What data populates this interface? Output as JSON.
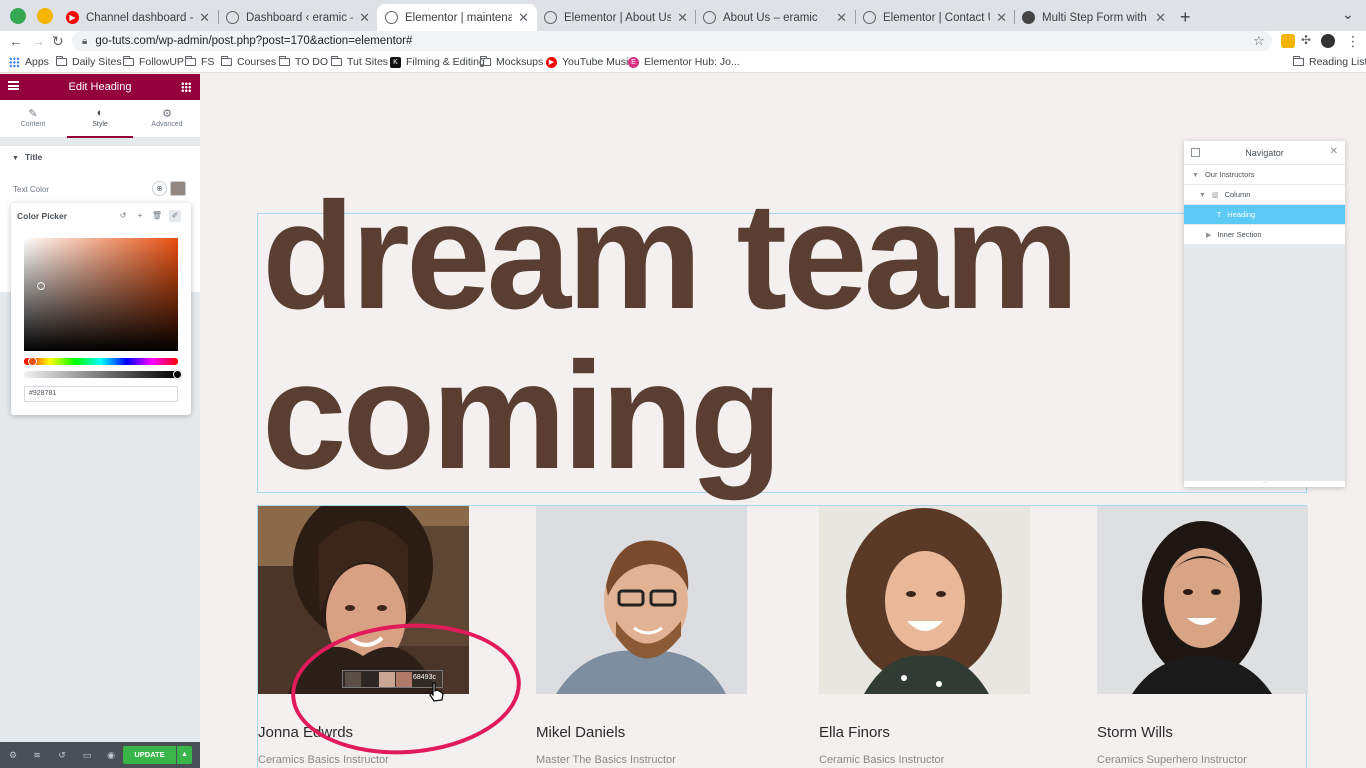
{
  "browser": {
    "tabs": [
      {
        "title": "Channel dashboard - YouTube",
        "favicon_color": "#ff0000"
      },
      {
        "title": "Dashboard ‹ eramic — WordPress",
        "favicon_color": "#5f6368"
      },
      {
        "title": "Elementor | maintenance",
        "favicon_color": "#5f6368",
        "active": true
      },
      {
        "title": "Elementor | About Us",
        "favicon_color": "#5f6368"
      },
      {
        "title": "About Us – eramic",
        "favicon_color": "#5f6368"
      },
      {
        "title": "Elementor | Contact Us",
        "favicon_color": "#5f6368"
      },
      {
        "title": "Multi Step Form with Progress",
        "favicon_color": "#5f6368"
      }
    ],
    "url": "go-tuts.com/wp-admin/post.php?post=170&action=elementor#",
    "bookmarks": [
      {
        "label": "Apps",
        "icon": "apps-grid-icon"
      },
      {
        "label": "Daily Sites",
        "icon": "folder-icon"
      },
      {
        "label": "FollowUP",
        "icon": "folder-icon"
      },
      {
        "label": "FS",
        "icon": "folder-icon"
      },
      {
        "label": "Courses",
        "icon": "folder-icon"
      },
      {
        "label": "TO DO",
        "icon": "folder-icon"
      },
      {
        "label": "Tut Sites",
        "icon": "folder-icon"
      },
      {
        "label": "Filming & Editing",
        "icon": "k-icon"
      },
      {
        "label": "Mocksups",
        "icon": "folder-icon"
      },
      {
        "label": "YouTube Music",
        "icon": "youtube-icon"
      },
      {
        "label": "Elementor Hub: Jo...",
        "icon": "elementor-icon"
      }
    ],
    "reading_list": "Reading List"
  },
  "panel": {
    "title": "Edit Heading",
    "tabs": [
      {
        "label": "Content",
        "icon": "pencil-icon"
      },
      {
        "label": "Style",
        "icon": "half-circle-icon",
        "active": true
      },
      {
        "label": "Advanced",
        "icon": "gear-icon"
      }
    ],
    "section_title": "Title",
    "text_color_label": "Text Color",
    "swatch_color": "#928781",
    "color_picker": {
      "title": "Color Picker",
      "hex_value": "#928781"
    },
    "update_label": "UPDATE"
  },
  "canvas": {
    "heading_line1": "dream team",
    "heading_line2": "coming",
    "heading_color": "#5b3e32",
    "members": [
      {
        "name": "Jonna Edwrds",
        "role": "Ceramics Basics Instructor"
      },
      {
        "name": "Mikel Daniels",
        "role": "Master The Basics Instructor"
      },
      {
        "name": "Ella Finors",
        "role": "Ceramic Basics Instructor"
      },
      {
        "name": "Storm Wills",
        "role": "Ceramics Superhero Instructor"
      }
    ],
    "eyedropper_hex": "68493c",
    "eyedropper_swatches": [
      "#5a4e47",
      "#2b2523",
      "#c9a594",
      "#b07a68"
    ]
  },
  "navigator": {
    "title": "Navigator",
    "items": [
      {
        "label": "Our Instructors"
      },
      {
        "label": "Column"
      },
      {
        "label": "Heading",
        "selected": true
      },
      {
        "label": "Inner Section"
      }
    ]
  }
}
